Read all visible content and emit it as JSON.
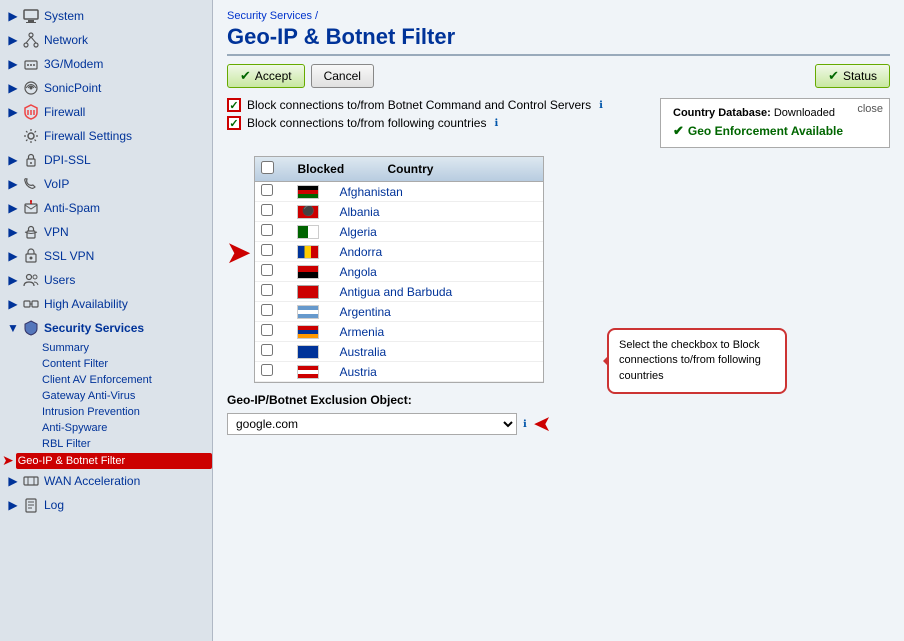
{
  "sidebar": {
    "items": [
      {
        "id": "system",
        "label": "System",
        "icon": "monitor",
        "expanded": false
      },
      {
        "id": "network",
        "label": "Network",
        "icon": "network",
        "expanded": false
      },
      {
        "id": "3gmodem",
        "label": "3G/Modem",
        "icon": "modem",
        "expanded": false
      },
      {
        "id": "sonicpoint",
        "label": "SonicPoint",
        "icon": "sonicpoint",
        "expanded": false
      },
      {
        "id": "firewall",
        "label": "Firewall",
        "icon": "firewall",
        "expanded": false
      },
      {
        "id": "firewall-settings",
        "label": "Firewall Settings",
        "icon": "settings",
        "expanded": false
      },
      {
        "id": "dpi-ssl",
        "label": "DPI-SSL",
        "icon": "lock",
        "expanded": false
      },
      {
        "id": "voip",
        "label": "VoIP",
        "icon": "phone",
        "expanded": false
      },
      {
        "id": "anti-spam",
        "label": "Anti-Spam",
        "icon": "spam",
        "expanded": false
      },
      {
        "id": "vpn",
        "label": "VPN",
        "icon": "vpn",
        "expanded": false
      },
      {
        "id": "ssl-vpn",
        "label": "SSL VPN",
        "icon": "ssl",
        "expanded": false
      },
      {
        "id": "users",
        "label": "Users",
        "icon": "users",
        "expanded": false
      },
      {
        "id": "high-availability",
        "label": "High Availability",
        "icon": "ha",
        "expanded": false
      },
      {
        "id": "security-services",
        "label": "Security Services",
        "icon": "shield",
        "expanded": true,
        "children": [
          {
            "id": "summary",
            "label": "Summary"
          },
          {
            "id": "content-filter",
            "label": "Content Filter"
          },
          {
            "id": "client-av",
            "label": "Client AV Enforcement"
          },
          {
            "id": "gateway-av",
            "label": "Gateway Anti-Virus"
          },
          {
            "id": "intrusion-prevention",
            "label": "Intrusion Prevention"
          },
          {
            "id": "anti-spyware",
            "label": "Anti-Spyware"
          },
          {
            "id": "rbl-filter",
            "label": "RBL Filter"
          },
          {
            "id": "geo-ip",
            "label": "Geo-IP & Botnet Filter",
            "active": true
          }
        ]
      },
      {
        "id": "wan-acceleration",
        "label": "WAN Acceleration",
        "icon": "wan",
        "expanded": false
      },
      {
        "id": "log",
        "label": "Log",
        "icon": "log",
        "expanded": false
      }
    ]
  },
  "header": {
    "breadcrumb": "Security Services /",
    "title": "Geo-IP & Botnet Filter"
  },
  "toolbar": {
    "accept_label": "Accept",
    "cancel_label": "Cancel",
    "status_label": "Status"
  },
  "checkboxes": {
    "botnet_label": "Block connections to/from Botnet Command and Control Servers",
    "countries_label": "Block connections to/from following countries",
    "botnet_checked": true,
    "countries_checked": true
  },
  "status_popup": {
    "close_label": "close",
    "db_label": "Country Database:",
    "db_value": "Downloaded",
    "geo_label": "Geo Enforcement Available"
  },
  "table": {
    "headers": {
      "blocked": "Blocked",
      "country": "Country"
    },
    "countries": [
      {
        "name": "Afghanistan",
        "flag_color1": "#000",
        "flag_color2": "#006400",
        "flag_color3": "#cc0000"
      },
      {
        "name": "Albania",
        "flag_color1": "#cc0000",
        "flag_color2": "#cc0000",
        "flag_color3": "#cc0000"
      },
      {
        "name": "Algeria",
        "flag_color1": "#006400",
        "flag_color2": "#fff",
        "flag_color3": "#cc0000"
      },
      {
        "name": "Andorra",
        "flag_color1": "#003399",
        "flag_color2": "#ffcc00",
        "flag_color3": "#cc0000"
      },
      {
        "name": "Angola",
        "flag_color1": "#cc0000",
        "flag_color2": "#000",
        "flag_color3": "#cc0000"
      },
      {
        "name": "Antigua and Barbuda",
        "flag_color1": "#cc0000",
        "flag_color2": "#000",
        "flag_color3": "#fff"
      },
      {
        "name": "Argentina",
        "flag_color1": "#6699cc",
        "flag_color2": "#fff",
        "flag_color3": "#6699cc"
      },
      {
        "name": "Armenia",
        "flag_color1": "#cc0000",
        "flag_color2": "#003399",
        "flag_color3": "#ff9900"
      },
      {
        "name": "Australia",
        "flag_color1": "#003399",
        "flag_color2": "#cc0000",
        "flag_color3": "#fff"
      },
      {
        "name": "Austria",
        "flag_color1": "#cc0000",
        "flag_color2": "#fff",
        "flag_color3": "#cc0000"
      }
    ]
  },
  "tooltip": {
    "text": "Select the checkbox to Block connections to/from following countries"
  },
  "exclusion": {
    "label": "Geo-IP/Botnet Exclusion Object:",
    "value": "google.com"
  },
  "colors": {
    "accent_red": "#cc0000",
    "accent_blue": "#003399",
    "bg_sidebar": "#dce3ea",
    "bg_main": "#f0f4f8",
    "active_item": "#cc0000"
  }
}
